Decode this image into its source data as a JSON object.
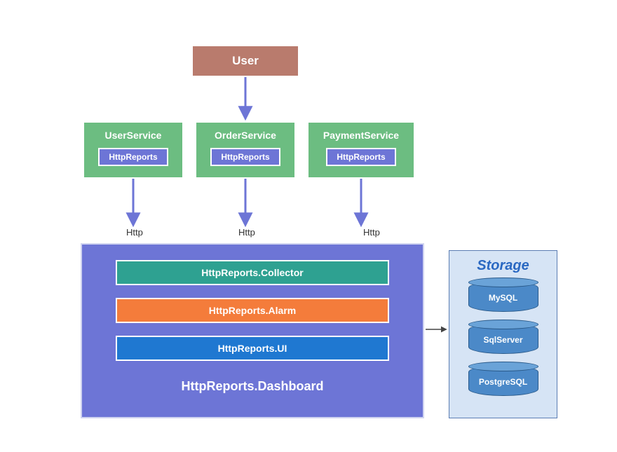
{
  "user": {
    "label": "User"
  },
  "services": [
    {
      "title": "UserService",
      "badge": "HttpReports"
    },
    {
      "title": "OrderService",
      "badge": "HttpReports"
    },
    {
      "title": "PaymentService",
      "badge": "HttpReports"
    }
  ],
  "http_labels": [
    "Http",
    "Http",
    "Http"
  ],
  "dashboard": {
    "collector": "HttpReports.Collector",
    "alarm": "HttpReports.Alarm",
    "ui": "HttpReports.UI",
    "title": "HttpReports.Dashboard"
  },
  "storage": {
    "title": "Storage",
    "databases": [
      "MySQL",
      "SqlServer",
      "PostgreSQL"
    ]
  },
  "colors": {
    "user_box": "#b97b6d",
    "service": "#6cbd81",
    "badge": "#6d75d6",
    "dashboard": "#6d75d6",
    "collector": "#2ea191",
    "alarm": "#f47c3b",
    "ui_row": "#1f78d1",
    "storage_bg": "#d6e4f5",
    "storage_title": "#2a68c2",
    "cylinder": "#4b89c8",
    "arrow": "#6d75d6",
    "arrow_dark": "#444"
  }
}
